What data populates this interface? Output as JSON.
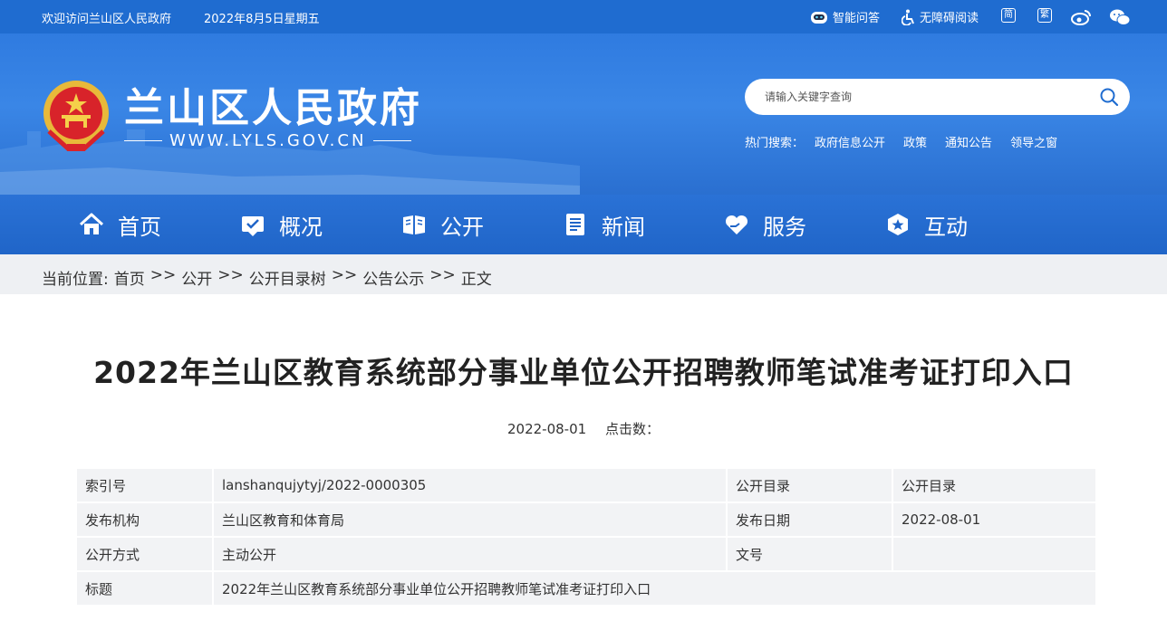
{
  "topbar": {
    "welcome": "欢迎访问兰山区人民政府",
    "date": "2022年8月5日星期五",
    "smart_qa": "智能问答",
    "accessibility": "无障碍阅读",
    "simplified": "简",
    "traditional": "繁"
  },
  "header": {
    "site_title": "兰山区人民政府",
    "site_url": "WWW.LYLS.GOV.CN",
    "search_placeholder": "请输入关键字查询",
    "hot_label": "热门搜索：",
    "hot_links": [
      "政府信息公开",
      "政策",
      "通知公告",
      "领导之窗"
    ]
  },
  "nav": {
    "items": [
      "首页",
      "概况",
      "公开",
      "新闻",
      "服务",
      "互动"
    ]
  },
  "breadcrumb": {
    "label": "当前位置:",
    "items": [
      "首页",
      "公开",
      "公开目录树",
      "公告公示",
      "正文"
    ],
    "separator": ">>"
  },
  "article": {
    "title": "2022年兰山区教育系统部分事业单位公开招聘教师笔试准考证打印入口",
    "date": "2022-08-01",
    "clicks_label": "点击数："
  },
  "info": {
    "index_no_label": "索引号",
    "index_no": "lanshanqujytyj/2022-0000305",
    "catalog_label": "公开目录",
    "catalog": "公开目录",
    "org_label": "发布机构",
    "org": "兰山区教育和体育局",
    "pub_date_label": "发布日期",
    "pub_date": "2022-08-01",
    "mode_label": "公开方式",
    "mode": "主动公开",
    "doc_no_label": "文号",
    "doc_no": "",
    "title_label": "标题",
    "title": "2022年兰山区教育系统部分事业单位公开招聘教师笔试准考证打印入口"
  },
  "colors": {
    "brand_blue": "#1f6cd0",
    "nav_blue": "#2065c8",
    "crumb_bg": "#eef0f3",
    "table_bg": "#f2f3f5"
  }
}
